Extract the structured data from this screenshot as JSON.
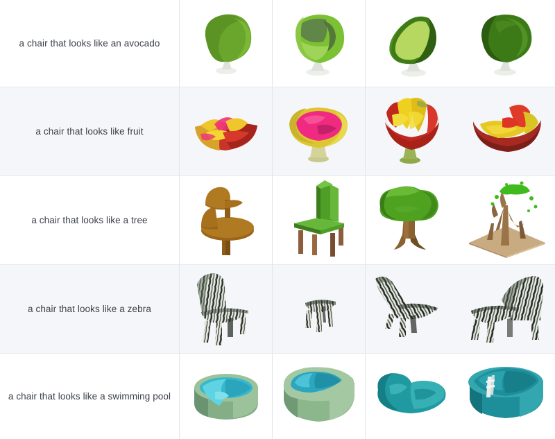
{
  "table": {
    "columns": 5,
    "render_columns": 4,
    "colors": {
      "row_shade": "#f5f6f9",
      "row_plain": "#ffffff",
      "divider": "#e3e5ea",
      "row_border": "#e7e9ee",
      "text": "#3a3f47"
    },
    "rows": [
      {
        "prompt": "a chair that looks like an avocado",
        "shaded": false,
        "renders": [
          {
            "name": "avocado-chair-render-1",
            "desc": "rounded green blob chair on white pedestal",
            "colors": {
              "main": "#6aa62c",
              "shade": "#4e8420",
              "light": "#8cc245",
              "base": "#e8eae6"
            }
          },
          {
            "name": "avocado-chair-render-2",
            "desc": "green bucket chair with dark seat cavity on white pedestal",
            "colors": {
              "main": "#7cc133",
              "shade": "#5c8f2a",
              "light": "#9ed457",
              "base": "#e8eae6"
            }
          },
          {
            "name": "avocado-chair-render-3",
            "desc": "avocado halved shell chair, pale green interior, white pedestal",
            "colors": {
              "main": "#3f7c18",
              "shade": "#2f5f12",
              "light": "#b7d860",
              "base": "#e8eae6"
            }
          },
          {
            "name": "avocado-chair-render-4",
            "desc": "dark green round blob chair on white pedestal",
            "colors": {
              "main": "#3c7a17",
              "shade": "#2c5c10",
              "light": "#55992a",
              "base": "#e8eae6"
            }
          }
        ]
      },
      {
        "prompt": "a chair that looks like fruit",
        "shaded": true,
        "renders": [
          {
            "name": "fruit-chair-render-1",
            "desc": "shallow yellow-red fruit bowl chair with pink pulp",
            "colors": {
              "main": "#c8342a",
              "shade": "#9b2a20",
              "light": "#efc62b",
              "accent": "#ef2f7a"
            }
          },
          {
            "name": "fruit-chair-render-2",
            "desc": "yellow rimmed bowl chair with magenta interior on stem base",
            "colors": {
              "main": "#dcc730",
              "shade": "#b09f26",
              "light": "#e9dd55",
              "accent": "#f02a80"
            }
          },
          {
            "name": "fruit-chair-render-3",
            "desc": "red goblet chair with yellow petal seat on green stem",
            "colors": {
              "main": "#c0271f",
              "shade": "#921d18",
              "light": "#efd020",
              "accent": "#8ea84a"
            }
          },
          {
            "name": "fruit-chair-render-4",
            "desc": "dark red bowl chair with yellow and red fruit wedges",
            "colors": {
              "main": "#a62a22",
              "shade": "#7d1e18",
              "light": "#e6c723",
              "accent": "#e03a28"
            }
          }
        ]
      },
      {
        "prompt": "a chair that looks like a tree",
        "shaded": false,
        "renders": [
          {
            "name": "tree-chair-render-1",
            "desc": "brown stump chair with round table-like seat and single leg",
            "colors": {
              "main": "#9a6518",
              "shade": "#7a4f12",
              "light": "#b07a22",
              "base": "#8a5a15"
            }
          },
          {
            "name": "tree-chair-render-2",
            "desc": "green high-back chair with brown wooden legs",
            "colors": {
              "main": "#4f9e28",
              "shade": "#3d7d1e",
              "light": "#67b83a",
              "base": "#8d5c3a"
            }
          },
          {
            "name": "tree-chair-render-3",
            "desc": "green leafy tree with brown trunk and roots",
            "colors": {
              "main": "#4ea220",
              "shade": "#3a7d18",
              "light": "#69bb36",
              "base": "#8a6230"
            }
          },
          {
            "name": "tree-chair-render-4",
            "desc": "sparse brown branching tree with green foliage on tan ground plane",
            "colors": {
              "main": "#9a7346",
              "shade": "#7a5a34",
              "light": "#c9ab82",
              "base": "#3fbb1e"
            }
          }
        ]
      },
      {
        "prompt": "a chair that looks like a zebra",
        "shaded": true,
        "renders": [
          {
            "name": "zebra-chair-render-1",
            "desc": "zebra striped dining chair with tall fanned back",
            "colors": {
              "main": "#e9ebe7",
              "shade": "#2a3129",
              "light": "#ffffff",
              "accent": "#5c6b58"
            }
          },
          {
            "name": "zebra-chair-render-2",
            "desc": "small zebra striped stool",
            "colors": {
              "main": "#e4e7e2",
              "shade": "#262c25",
              "light": "#ffffff",
              "accent": "#5a6856"
            }
          },
          {
            "name": "zebra-chair-render-3",
            "desc": "zebra striped lounge chair angled back, long seat",
            "colors": {
              "main": "#e7eae5",
              "shade": "#232a22",
              "light": "#ffffff",
              "accent": "#56654f"
            }
          },
          {
            "name": "zebra-chair-render-4",
            "desc": "zebra striped wide lounge chair facing left",
            "colors": {
              "main": "#e8ebe6",
              "shade": "#242b23",
              "light": "#ffffff",
              "accent": "#5a6a55"
            }
          }
        ]
      },
      {
        "prompt": "a chair that looks like a swimming pool",
        "shaded": false,
        "renders": [
          {
            "name": "pool-chair-render-1",
            "desc": "round sage green tub chair with cyan water basin",
            "colors": {
              "main": "#84ae86",
              "shade": "#6a9470",
              "light": "#9cc29c",
              "accent": "#35b9cf"
            }
          },
          {
            "name": "pool-chair-render-2",
            "desc": "oval sage green pool seat with teal water surface",
            "colors": {
              "main": "#8cb78d",
              "shade": "#6f9a74",
              "light": "#a3c8a2",
              "accent": "#2ba6bd"
            }
          },
          {
            "name": "pool-chair-render-3",
            "desc": "flat teal kidney shaped pool form",
            "colors": {
              "main": "#1f9aa0",
              "shade": "#167f86",
              "light": "#36b0b4",
              "accent": "#2ba6bd"
            }
          },
          {
            "name": "pool-chair-render-4",
            "desc": "round teal pool basin with step ladder and water",
            "colors": {
              "main": "#1d8f9a",
              "shade": "#15737e",
              "light": "#33a6af",
              "accent": "#e8efec"
            }
          }
        ]
      }
    ]
  }
}
